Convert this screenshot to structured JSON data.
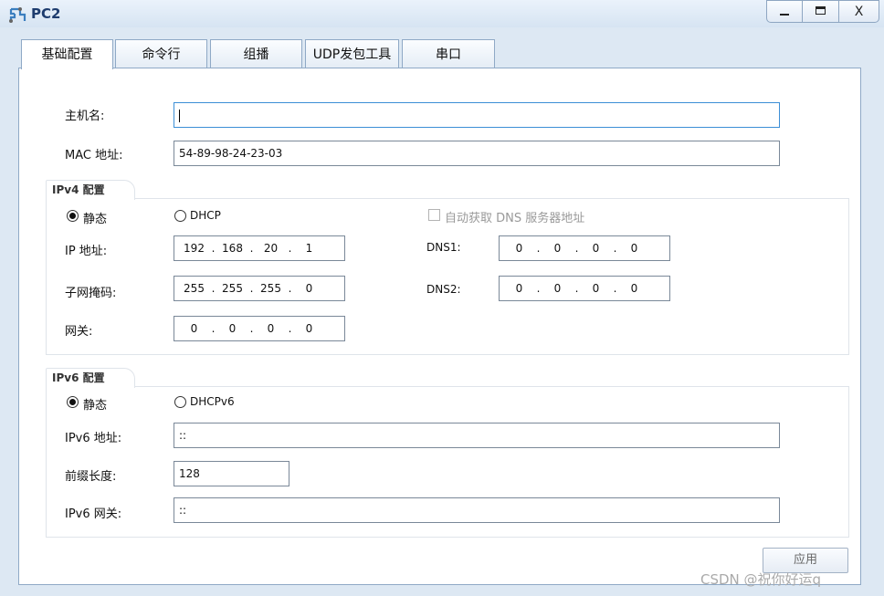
{
  "window": {
    "title": "PC2",
    "min_label": "_",
    "max_label": "□",
    "close_label": "X"
  },
  "tabs": [
    {
      "label": "基础配置"
    },
    {
      "label": "命令行"
    },
    {
      "label": "组播"
    },
    {
      "label": "UDP发包工具"
    },
    {
      "label": "串口"
    }
  ],
  "basic": {
    "hostname_label": "主机名:",
    "hostname_value": "",
    "mac_label": "MAC 地址:",
    "mac_value": "54-89-98-24-23-03"
  },
  "ipv4": {
    "group_title": "IPv4 配置",
    "static_label": "静态",
    "dhcp_label": "DHCP",
    "mode": "static",
    "auto_dns_label": "自动获取 DNS 服务器地址",
    "auto_dns_checked": false,
    "ip_label": "IP 地址:",
    "ip": [
      "192",
      "168",
      "20",
      "1"
    ],
    "mask_label": "子网掩码:",
    "mask": [
      "255",
      "255",
      "255",
      "0"
    ],
    "gateway_label": "网关:",
    "gateway": [
      "0",
      "0",
      "0",
      "0"
    ],
    "dns1_label": "DNS1:",
    "dns1": [
      "0",
      "0",
      "0",
      "0"
    ],
    "dns2_label": "DNS2:",
    "dns2": [
      "0",
      "0",
      "0",
      "0"
    ]
  },
  "ipv6": {
    "group_title": "IPv6 配置",
    "static_label": "静态",
    "dhcp_label": "DHCPv6",
    "mode": "static",
    "addr_label": "IPv6 地址:",
    "addr_value": "::",
    "prefix_label": "前缀长度:",
    "prefix_value": "128",
    "gateway_label": "IPv6 网关:",
    "gateway_value": "::"
  },
  "apply_label": "应用",
  "watermark": "CSDN @祝你好运q",
  "colors": {
    "focus_border": "#3c8fd6",
    "title_text": "#1d3c6e"
  }
}
